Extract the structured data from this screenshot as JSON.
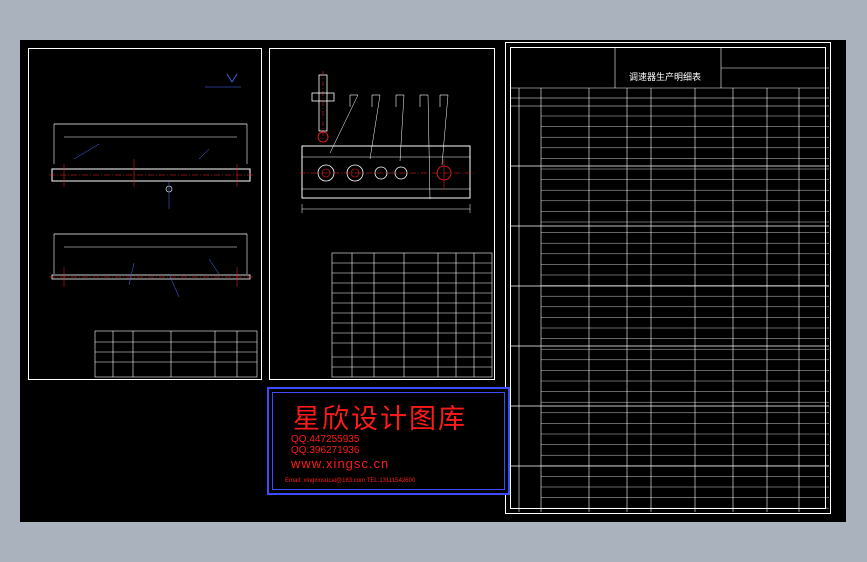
{
  "watermark": {
    "title": "星欣设计图库",
    "qq1": "QQ:447255935",
    "qq2": "QQ:396271936",
    "url": "www.xingsc.cn",
    "contact": "Email: xingxinsucai@163.com   TEL:13111542600"
  },
  "table": {
    "title": "调速器生产明细表"
  },
  "colors": {
    "background": "#a9b2bd",
    "canvas": "#000000",
    "lines": "#ffffff",
    "annotation": "#4f6cff",
    "dimension": "#ff2020",
    "watermark": "#ff1a1a"
  }
}
